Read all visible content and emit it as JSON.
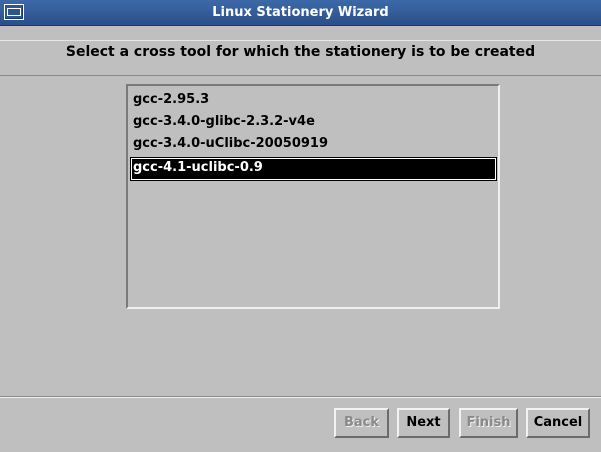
{
  "window": {
    "title": "Linux Stationery Wizard"
  },
  "header": {
    "instruction": "Select a cross tool for which the stationery is to be created"
  },
  "toolchains": {
    "items": [
      "gcc-2.95.3",
      "gcc-3.4.0-glibc-2.3.2-v4e",
      "gcc-3.4.0-uClibc-20050919",
      "gcc-4.1-uclibc-0.9"
    ],
    "selected": "gcc-4.1-uclibc-0.9"
  },
  "buttons": {
    "back": "Back",
    "next": "Next",
    "finish": "Finish",
    "cancel": "Cancel"
  },
  "colors": {
    "titlebar": "#2f5a96",
    "dialog_bg": "#bfbfbf",
    "selection_bg": "#000000",
    "selection_fg": "#ffffff"
  },
  "icons": {
    "window_menu": "window-menu-icon"
  }
}
